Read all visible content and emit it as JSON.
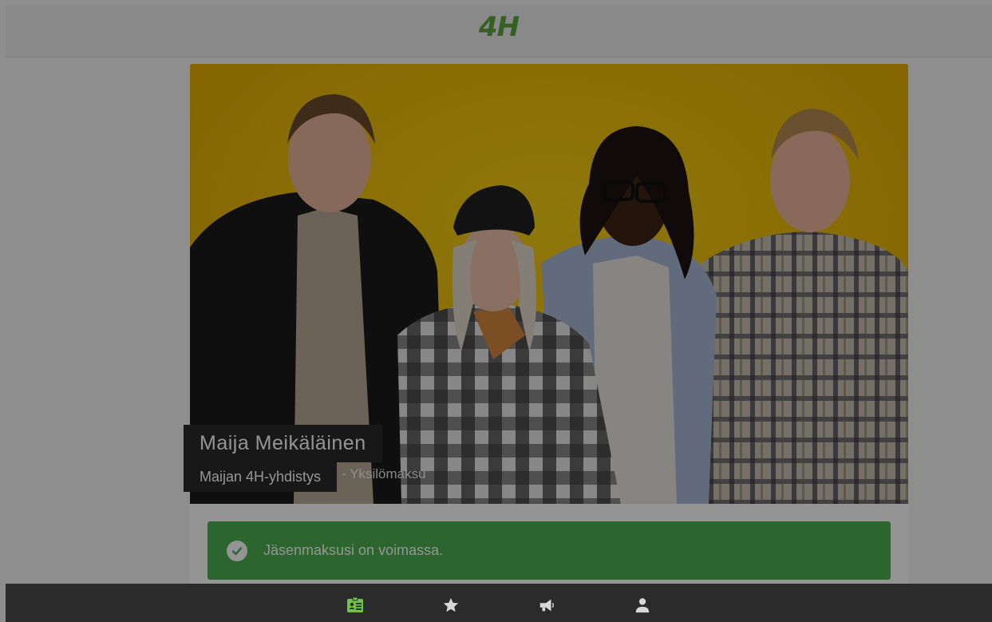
{
  "header": {
    "logo_text": "4H"
  },
  "profile": {
    "name": "Maija Meikäläinen",
    "organization": "Maijan 4H-yhdistys",
    "membership_type": "- Yksilömaksu"
  },
  "status": {
    "message": "Jäsenmaksusi on voimassa.",
    "icon": "check-circle-icon",
    "color": "#4caf50"
  },
  "bottom_nav": {
    "items": [
      {
        "icon": "id-card-icon",
        "label": "",
        "active": true
      },
      {
        "icon": "star-icon",
        "label": "",
        "active": false
      },
      {
        "icon": "megaphone-icon",
        "label": "",
        "active": false
      },
      {
        "icon": "person-icon",
        "label": "",
        "active": false
      }
    ]
  },
  "colors": {
    "brand_green": "#5aa73b",
    "hero_background": "#f2c200",
    "nav_background": "#2b2b2b"
  }
}
